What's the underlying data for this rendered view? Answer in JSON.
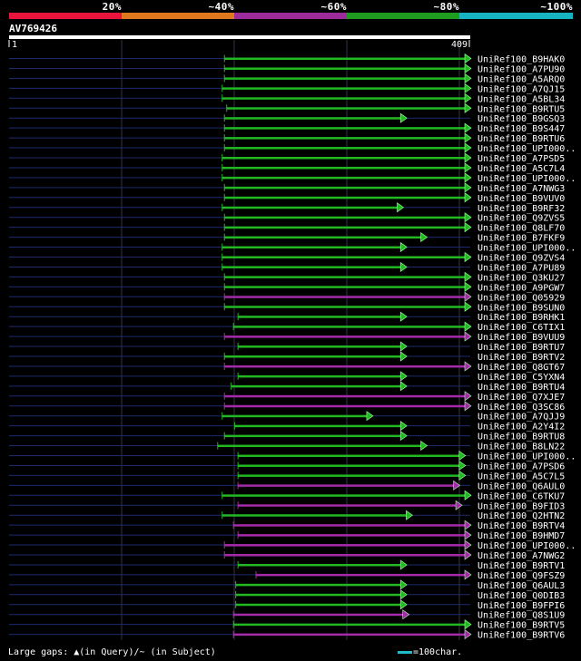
{
  "legend": {
    "labels": [
      "20%",
      "~40%",
      "~60%",
      "~80%",
      "~100%"
    ],
    "colors": [
      "#e8143c",
      "#e0781e",
      "#9c2b9c",
      "#1f9c1f",
      "#16b4c0"
    ]
  },
  "query": {
    "name": "AV769426",
    "start_label": "1",
    "end_label": "409"
  },
  "footer": {
    "gaps_text": "Large gaps: ▲(in Query)/~ (in Subject)",
    "scale_text": "=100char."
  },
  "chart_data": {
    "type": "alignment",
    "query_length": 409,
    "colors": {
      "green": "#22b822",
      "purple": "#a52aaa",
      "line": "#1e2a6e",
      "ref": "#ffffff"
    },
    "hits": [
      {
        "name": "UniRef100_B9HAK0",
        "start": 191,
        "end": 409,
        "color": "green"
      },
      {
        "name": "UniRef100_A7PU90",
        "start": 191,
        "end": 409,
        "color": "green"
      },
      {
        "name": "UniRef100_A5ARQ0",
        "start": 191,
        "end": 409,
        "color": "green"
      },
      {
        "name": "UniRef100_A7QJ15",
        "start": 189,
        "end": 409,
        "color": "green"
      },
      {
        "name": "UniRef100_A5BL34",
        "start": 189,
        "end": 409,
        "color": "green"
      },
      {
        "name": "UniRef100_B9RTU5",
        "start": 193,
        "end": 409,
        "color": "green"
      },
      {
        "name": "UniRef100_B9GSQ3",
        "start": 191,
        "end": 352,
        "color": "green"
      },
      {
        "name": "UniRef100_B9S447",
        "start": 191,
        "end": 409,
        "color": "green"
      },
      {
        "name": "UniRef100_B9RTU6",
        "start": 191,
        "end": 409,
        "color": "green"
      },
      {
        "name": "UniRef100_UPI000..",
        "start": 191,
        "end": 409,
        "color": "green"
      },
      {
        "name": "UniRef100_A7PSD5",
        "start": 189,
        "end": 409,
        "color": "green"
      },
      {
        "name": "UniRef100_A5C7L4",
        "start": 189,
        "end": 409,
        "color": "green"
      },
      {
        "name": "UniRef100_UPI000..",
        "start": 189,
        "end": 409,
        "color": "green"
      },
      {
        "name": "UniRef100_A7NWG3",
        "start": 191,
        "end": 409,
        "color": "green"
      },
      {
        "name": "UniRef100_B9VUV0",
        "start": 191,
        "end": 409,
        "color": "green"
      },
      {
        "name": "UniRef100_B9RF32",
        "start": 189,
        "end": 349,
        "color": "green"
      },
      {
        "name": "UniRef100_Q9ZVS5",
        "start": 191,
        "end": 409,
        "color": "green"
      },
      {
        "name": "UniRef100_Q8LF70",
        "start": 191,
        "end": 409,
        "color": "green"
      },
      {
        "name": "UniRef100_B7FKF9",
        "start": 191,
        "end": 370,
        "color": "green"
      },
      {
        "name": "UniRef100_UPI000..",
        "start": 189,
        "end": 352,
        "color": "green"
      },
      {
        "name": "UniRef100_Q9ZVS4",
        "start": 189,
        "end": 409,
        "color": "green"
      },
      {
        "name": "UniRef100_A7PU89",
        "start": 189,
        "end": 352,
        "color": "green"
      },
      {
        "name": "UniRef100_Q3KU27",
        "start": 191,
        "end": 409,
        "color": "green"
      },
      {
        "name": "UniRef100_A9PGW7",
        "start": 191,
        "end": 409,
        "color": "green"
      },
      {
        "name": "UniRef100_Q05929",
        "start": 191,
        "end": 409,
        "color": "purple"
      },
      {
        "name": "UniRef100_B9SUN0",
        "start": 191,
        "end": 409,
        "color": "green"
      },
      {
        "name": "UniRef100_B9RHK1",
        "start": 203,
        "end": 352,
        "color": "green"
      },
      {
        "name": "UniRef100_C6TIX1",
        "start": 199,
        "end": 409,
        "color": "green"
      },
      {
        "name": "UniRef100_B9VUU9",
        "start": 191,
        "end": 409,
        "color": "purple"
      },
      {
        "name": "UniRef100_B9RTU7",
        "start": 203,
        "end": 352,
        "color": "green"
      },
      {
        "name": "UniRef100_B9RTV2",
        "start": 191,
        "end": 352,
        "color": "green"
      },
      {
        "name": "UniRef100_Q8GT67",
        "start": 191,
        "end": 409,
        "color": "purple"
      },
      {
        "name": "UniRef100_C5YXN4",
        "start": 203,
        "end": 352,
        "color": "green"
      },
      {
        "name": "UniRef100_B9RTU4",
        "start": 197,
        "end": 352,
        "color": "green"
      },
      {
        "name": "UniRef100_Q7XJE7",
        "start": 191,
        "end": 409,
        "color": "purple"
      },
      {
        "name": "UniRef100_Q3SC86",
        "start": 191,
        "end": 409,
        "color": "purple"
      },
      {
        "name": "UniRef100_A7QJJ9",
        "start": 189,
        "end": 322,
        "color": "green"
      },
      {
        "name": "UniRef100_A2Y4I2",
        "start": 200,
        "end": 352,
        "color": "green"
      },
      {
        "name": "UniRef100_B9RTU8",
        "start": 191,
        "end": 352,
        "color": "green"
      },
      {
        "name": "UniRef100_B8LN22",
        "start": 185,
        "end": 370,
        "color": "green"
      },
      {
        "name": "UniRef100_UPI000..",
        "start": 203,
        "end": 404,
        "color": "green"
      },
      {
        "name": "UniRef100_A7PSD6",
        "start": 203,
        "end": 404,
        "color": "green"
      },
      {
        "name": "UniRef100_A5C7L5",
        "start": 203,
        "end": 404,
        "color": "green"
      },
      {
        "name": "UniRef100_Q6AUL0",
        "start": 203,
        "end": 399,
        "color": "purple"
      },
      {
        "name": "UniRef100_C6TKU7",
        "start": 189,
        "end": 409,
        "color": "green"
      },
      {
        "name": "UniRef100_B9FID3",
        "start": 203,
        "end": 401,
        "color": "purple"
      },
      {
        "name": "UniRef100_Q2HTN2",
        "start": 189,
        "end": 357,
        "color": "green"
      },
      {
        "name": "UniRef100_B9RTV4",
        "start": 199,
        "end": 409,
        "color": "purple"
      },
      {
        "name": "UniRef100_B9HMD7",
        "start": 203,
        "end": 409,
        "color": "purple"
      },
      {
        "name": "UniRef100_UPI000..",
        "start": 191,
        "end": 409,
        "color": "purple"
      },
      {
        "name": "UniRef100_A7NWG2",
        "start": 191,
        "end": 409,
        "color": "purple"
      },
      {
        "name": "UniRef100_B9RTV1",
        "start": 203,
        "end": 352,
        "color": "green"
      },
      {
        "name": "UniRef100_Q9FSZ9",
        "start": 219,
        "end": 409,
        "color": "purple"
      },
      {
        "name": "UniRef100_Q6AUL3",
        "start": 201,
        "end": 352,
        "color": "green"
      },
      {
        "name": "UniRef100_Q0DIB3",
        "start": 201,
        "end": 352,
        "color": "green"
      },
      {
        "name": "UniRef100_B9FPI6",
        "start": 201,
        "end": 352,
        "color": "green"
      },
      {
        "name": "UniRef100_Q8S1U9",
        "start": 199,
        "end": 354,
        "color": "purple"
      },
      {
        "name": "UniRef100_B9RTV5",
        "start": 199,
        "end": 409,
        "color": "green"
      },
      {
        "name": "UniRef100_B9RTV6",
        "start": 199,
        "end": 409,
        "color": "purple"
      }
    ]
  }
}
